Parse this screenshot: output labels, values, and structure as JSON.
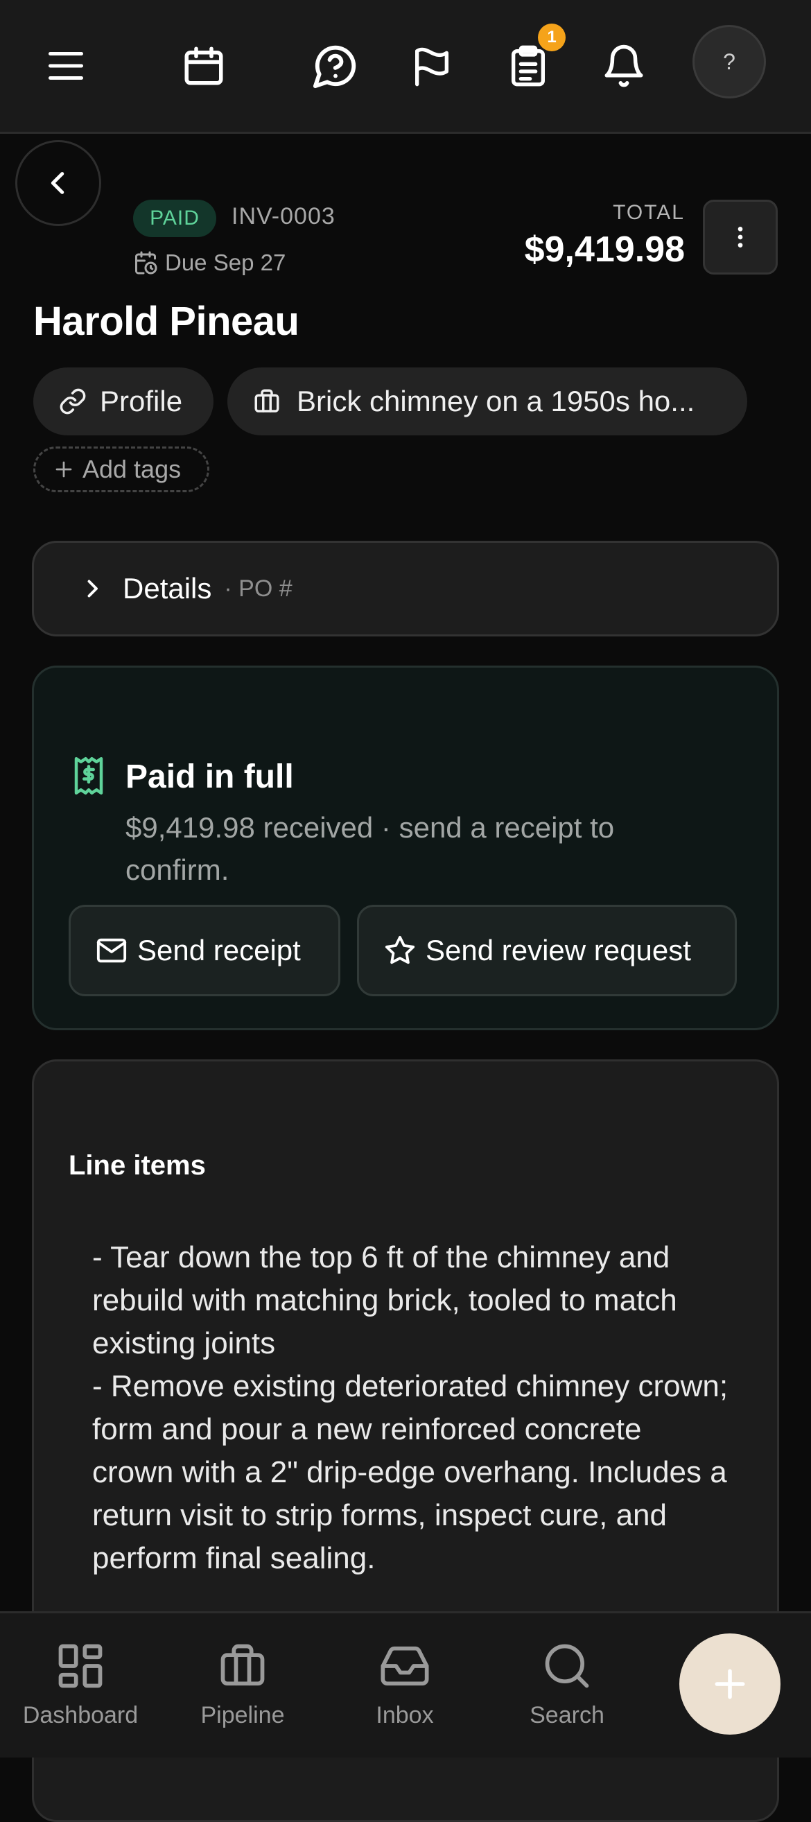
{
  "topbar": {
    "icons": [
      "menu-icon",
      "calendar-icon",
      "help-chat-icon",
      "flag-icon",
      "clipboard-icon",
      "bell-icon"
    ],
    "clipboard_badge": "1",
    "avatar_label": "?"
  },
  "invoice": {
    "status": "PAID",
    "number": "INV-0003",
    "due": "Due Sep 27",
    "total_label": "TOTAL",
    "total": "$9,419.98",
    "customer_name": "Harold Pineau"
  },
  "chips": {
    "profile": "Profile",
    "job": "Brick chimney on a 1950s ho...",
    "add_tags": "Add tags"
  },
  "details": {
    "label": "Details",
    "po": "· PO #"
  },
  "payment": {
    "title": "Paid in full",
    "subtitle": "$9,419.98 received · send a receipt to confirm.",
    "send_receipt": "Send receipt",
    "send_review": "Send review request",
    "accent": "#5fd39a"
  },
  "line_items": {
    "title": "Line items",
    "text": "- Tear down the top 6 ft of the chimney and rebuild with matching brick, tooled to match existing joints\n- Remove existing deteriorated chimney crown; form and pour a new reinforced concrete crown with a 2\" drip-edge overhang. Includes a return visit to strip forms, inspect cure, and perform final sealing."
  },
  "bottom_nav": {
    "items": [
      "Dashboard",
      "Pipeline",
      "Inbox",
      "Search"
    ],
    "fab_icon": "plus-icon",
    "fab_color": "#ece0d0"
  }
}
